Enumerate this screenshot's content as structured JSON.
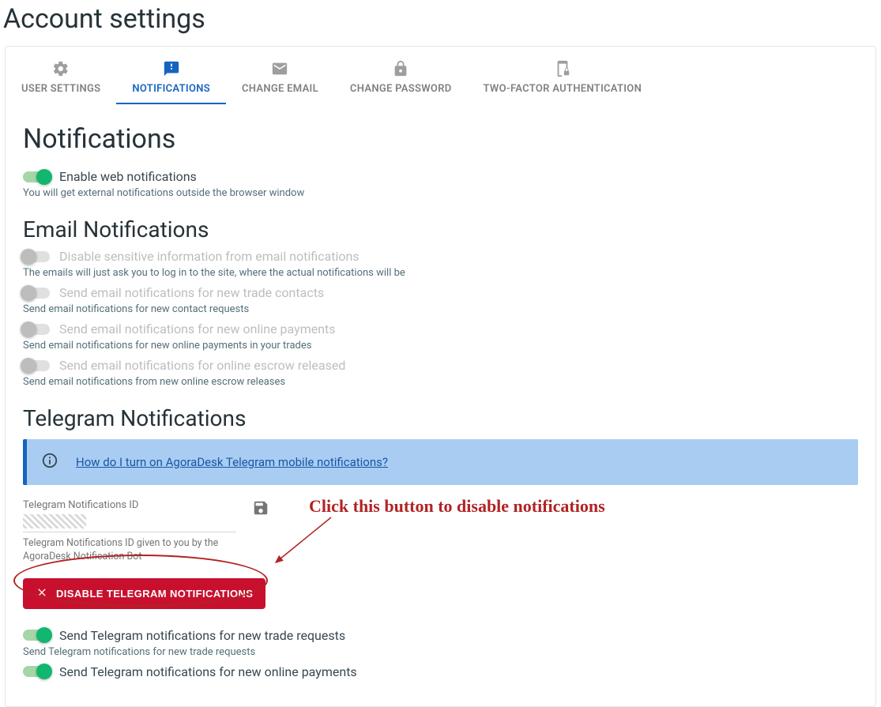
{
  "page_title": "Account settings",
  "tabs": {
    "user_settings": "USER SETTINGS",
    "notifications": "NOTIFICATIONS",
    "change_email": "CHANGE EMAIL",
    "change_password": "CHANGE PASSWORD",
    "two_factor": "TWO-FACTOR AUTHENTICATION"
  },
  "section": {
    "title": "Notifications",
    "web": {
      "label": "Enable web notifications",
      "helper": "You will get external notifications outside the browser window"
    },
    "email_title": "Email Notifications",
    "email": {
      "disable_sensitive": {
        "label": "Disable sensitive information from email notifications",
        "helper": "The emails will just ask you to log in to the site, where the actual notifications will be"
      },
      "trade_contacts": {
        "label": "Send email notifications for new trade contacts",
        "helper": "Send email notifications for new contact requests"
      },
      "online_payments": {
        "label": "Send email notifications for new online payments",
        "helper": "Send email notifications for new online payments in your trades"
      },
      "escrow_released": {
        "label": "Send email notifications for online escrow released",
        "helper": "Send email notifications from new online escrow releases"
      }
    },
    "telegram_title": "Telegram Notifications",
    "telegram": {
      "banner_link": "How do I turn on AgoraDesk Telegram mobile notifications?",
      "id_label": "Telegram Notifications ID",
      "id_helper": "Telegram Notifications ID given to you by the AgoraDesk Notification Bot",
      "disable_btn": "DISABLE TELEGRAM NOTIFICATIONS",
      "trade_requests": {
        "label": "Send Telegram notifications for new trade requests",
        "helper": "Send Telegram notifications for new trade requests"
      },
      "online_payments": {
        "label": "Send Telegram notifications for new online payments"
      }
    }
  },
  "annotation": {
    "text": "Click this button to disable notifications"
  }
}
